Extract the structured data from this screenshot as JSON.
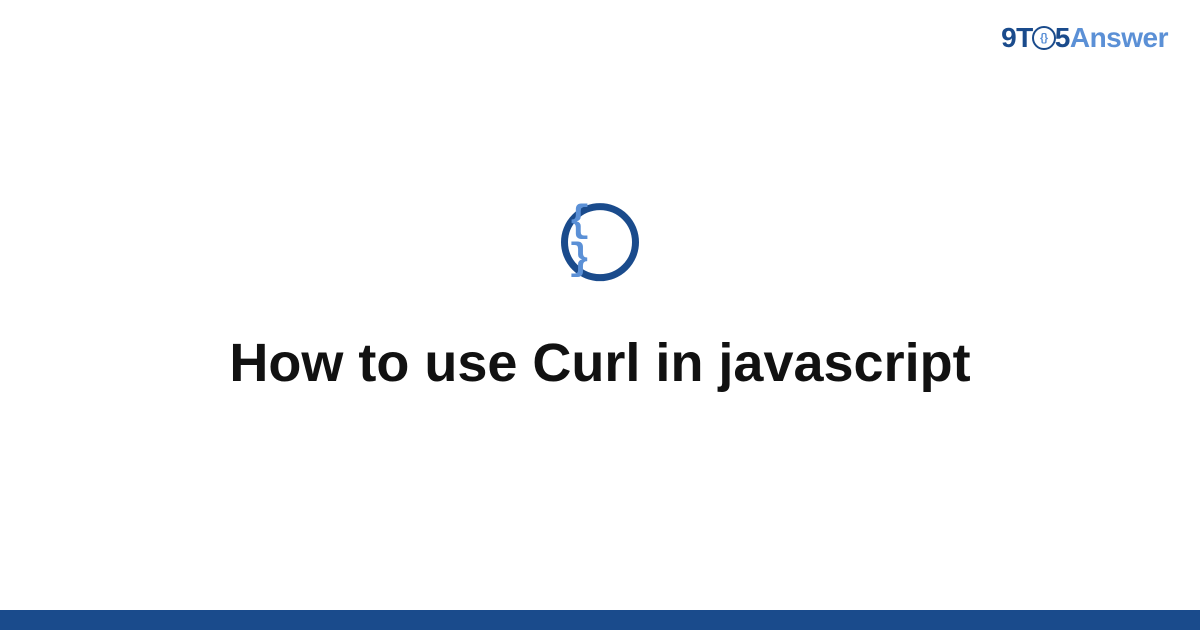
{
  "brand": {
    "part1": "9T",
    "part2": "5",
    "part3": "Answer"
  },
  "icon": {
    "glyph": "{ }",
    "name": "code-braces-icon"
  },
  "main": {
    "title": "How to use Curl in javascript"
  },
  "colors": {
    "primary": "#1a4b8c",
    "accent": "#5b90d6",
    "text": "#111111",
    "background": "#ffffff"
  }
}
